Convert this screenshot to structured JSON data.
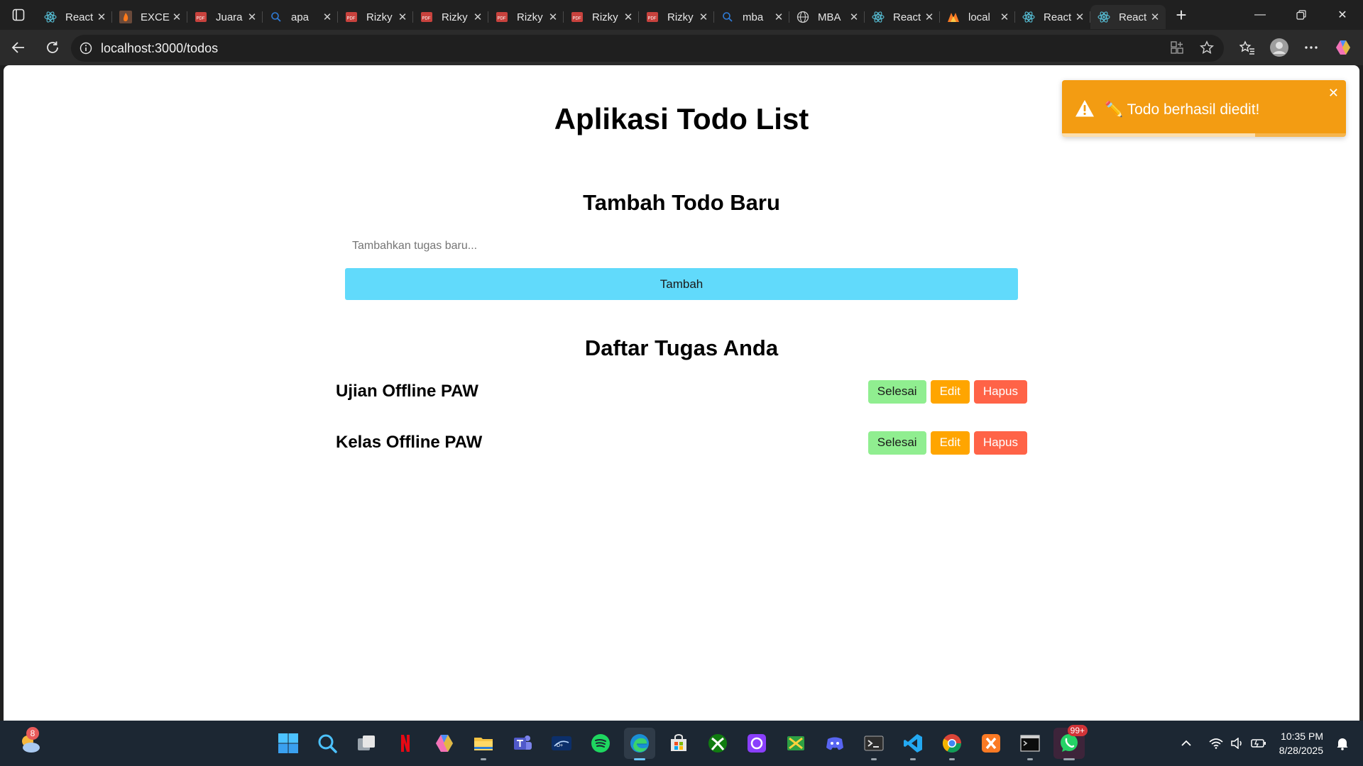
{
  "browser": {
    "tabs": [
      {
        "title": "React App",
        "icon": "react"
      },
      {
        "title": "EXCEL",
        "icon": "fire"
      },
      {
        "title": "Juara",
        "icon": "pdf"
      },
      {
        "title": "apa",
        "icon": "search"
      },
      {
        "title": "Rizky",
        "icon": "pdf"
      },
      {
        "title": "Rizky",
        "icon": "pdf"
      },
      {
        "title": "Rizky",
        "icon": "pdf"
      },
      {
        "title": "Rizky",
        "icon": "pdf"
      },
      {
        "title": "Rizky",
        "icon": "pdf"
      },
      {
        "title": "mba",
        "icon": "search"
      },
      {
        "title": "MBA",
        "icon": "globe"
      },
      {
        "title": "React",
        "icon": "react"
      },
      {
        "title": "local",
        "icon": "xampp"
      },
      {
        "title": "React",
        "icon": "react"
      },
      {
        "title": "React",
        "icon": "react",
        "active": true
      }
    ],
    "url": "localhost:3000/todos"
  },
  "page": {
    "title": "Aplikasi Todo List",
    "add_heading": "Tambah Todo Baru",
    "input_placeholder": "Tambahkan tugas baru...",
    "input_value": "",
    "add_button": "Tambah",
    "list_heading": "Daftar Tugas Anda",
    "todos": [
      {
        "text": "Ujian Offline PAW",
        "done_label": "Selesai",
        "edit_label": "Edit",
        "delete_label": "Hapus"
      },
      {
        "text": "Kelas Offline PAW",
        "done_label": "Selesai",
        "edit_label": "Edit",
        "delete_label": "Hapus"
      }
    ]
  },
  "toast": {
    "message": "✏️ Todo berhasil diedit!",
    "type": "warning",
    "progress_remaining": 0.68,
    "close": "✕"
  },
  "colors": {
    "toast": "#f39c12",
    "add_button": "#61dafb",
    "done_button": "#90ee90",
    "edit_button": "#ffa500",
    "delete_button": "#ff6347"
  },
  "taskbar": {
    "weather_badge": "8",
    "whatsapp_badge": "99+",
    "time": "10:35 PM",
    "date": "8/28/2025"
  }
}
